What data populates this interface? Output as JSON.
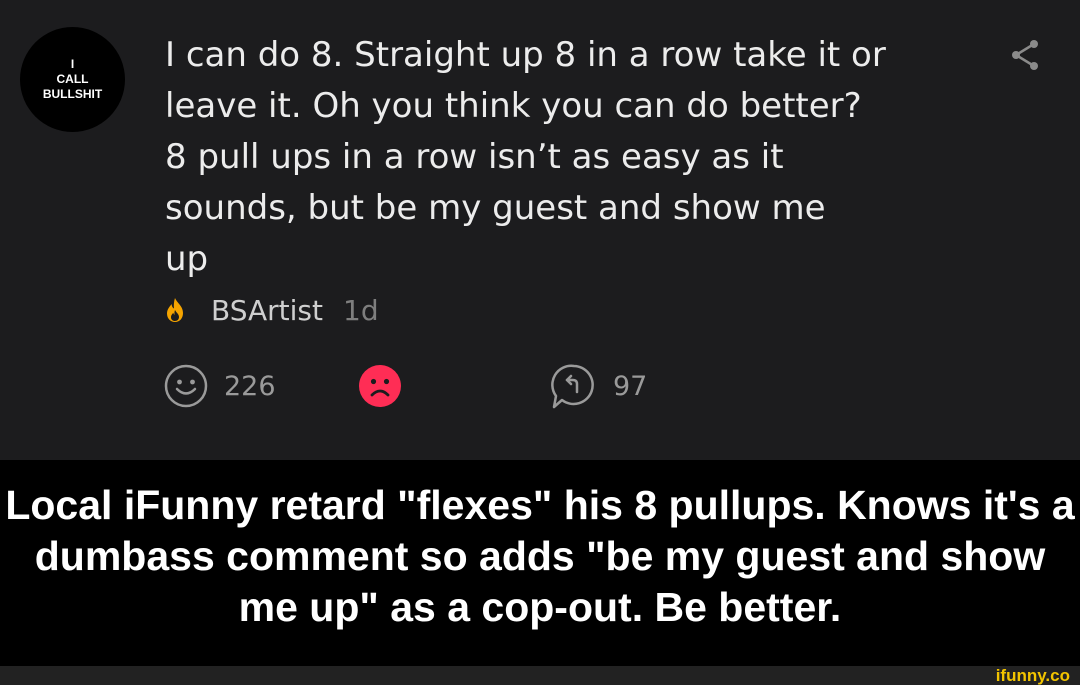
{
  "avatar": {
    "lines": [
      "I",
      "CALL",
      "BULLSHIT"
    ]
  },
  "comment": {
    "text": "I can do 8. Straight up 8 in a row take it or\nleave it. Oh you think you can do better?\n8 pull ups in a row isn’t as easy as it\nsounds, but be my guest and show me\nup"
  },
  "author": {
    "name": "BSArtist",
    "time": "1d"
  },
  "actions": {
    "smile_count": "226",
    "reply_count": "97"
  },
  "caption": "Local iFunny retard \"flexes\" his 8 pullups. Knows it's a dumbass comment so adds \"be my guest and show me up\" as a cop-out. Be better.",
  "watermark": "ifunny.co",
  "icons": {
    "share": "share-icon",
    "flame": "flame-icon",
    "smile": "smile-icon",
    "sad": "sad-face-icon",
    "reply": "reply-icon"
  },
  "colors": {
    "flame": "#f5a400",
    "sad": "#ff2d55",
    "watermark": "#f2c400"
  }
}
